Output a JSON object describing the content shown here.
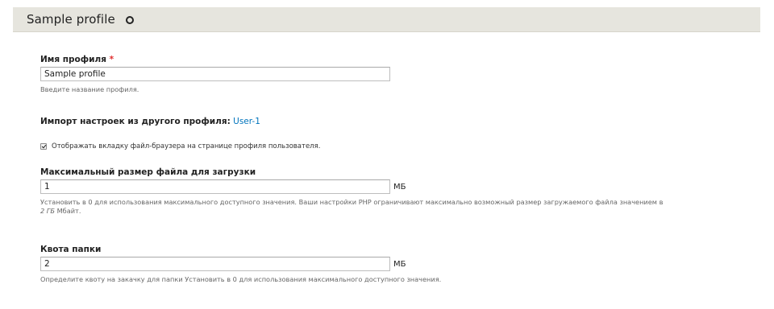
{
  "header": {
    "title": "Sample profile"
  },
  "profile_name": {
    "label": "Имя профиля",
    "required_mark": "*",
    "value": "Sample profile",
    "description": "Введите название профиля."
  },
  "import": {
    "label": "Импорт настроек из другого профиля",
    "separator": ":",
    "link_text": "User-1"
  },
  "show_browser_tab": {
    "checked": true,
    "label": "Отображать вкладку файл-браузера на странице профиля пользователя."
  },
  "max_file_size": {
    "label": "Максимальный размер файла для загрузки",
    "value": "1",
    "unit": "МБ",
    "description_line1": "Установить в 0 для использования максимального доступного значения. Ваши настройки PHP ограничивают максимально возможный размер загружаемого файла значением в",
    "description_em": "2 ГБ",
    "description_suffix": " Мбайт."
  },
  "folder_quota": {
    "label": "Квота папки",
    "value": "2",
    "unit": "МБ",
    "description": "Определите квоту на закачку для папки Установить в 0 для использования максимального доступного значения."
  }
}
